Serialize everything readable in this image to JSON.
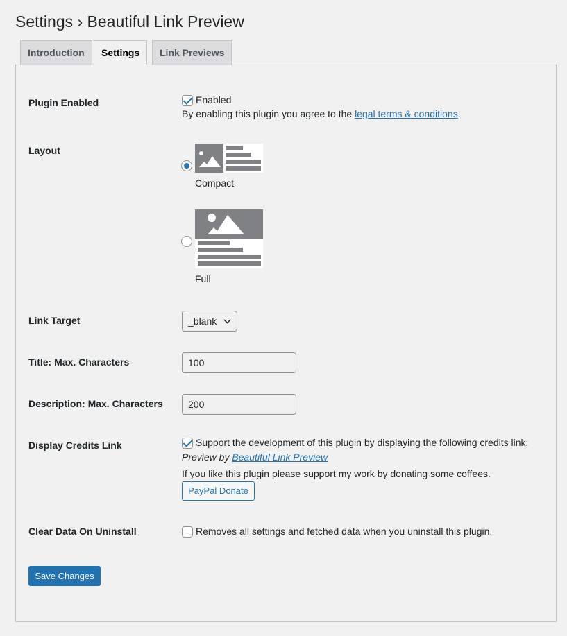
{
  "title": "Settings › Beautiful Link Preview",
  "tabs": [
    {
      "label": "Introduction"
    },
    {
      "label": "Settings",
      "active": true
    },
    {
      "label": "Link Previews"
    }
  ],
  "plugin_enabled": {
    "label": "Plugin Enabled",
    "checkbox_label": "Enabled",
    "checked": true,
    "terms_prefix": "By enabling this plugin you agree to the ",
    "terms_link": "legal terms & conditions",
    "terms_suffix": "."
  },
  "layout": {
    "label": "Layout",
    "options": [
      {
        "label": "Compact",
        "selected": true,
        "icon": "compact-layout-icon"
      },
      {
        "label": "Full",
        "selected": false,
        "icon": "full-layout-icon"
      }
    ]
  },
  "link_target": {
    "label": "Link Target",
    "value": "_blank"
  },
  "title_max": {
    "label": "Title: Max. Characters",
    "value": "100"
  },
  "desc_max": {
    "label": "Description: Max. Characters",
    "value": "200"
  },
  "credits": {
    "label": "Display Credits Link",
    "checked": true,
    "checkbox_label": "Support the development of this plugin by displaying the following credits link:",
    "preview_prefix": "Preview by ",
    "preview_link": "Beautiful Link Preview",
    "donate_text": "If you like this plugin please support my work by donating some coffees.",
    "donate_button": "PayPal Donate"
  },
  "clear_data": {
    "label": "Clear Data On Uninstall",
    "checked": false,
    "checkbox_label": "Removes all settings and fetched data when you uninstall this plugin."
  },
  "save_button": "Save Changes",
  "colors": {
    "accent": "#2271b1",
    "background": "#f1f1f1",
    "icon_gray": "#808184"
  }
}
